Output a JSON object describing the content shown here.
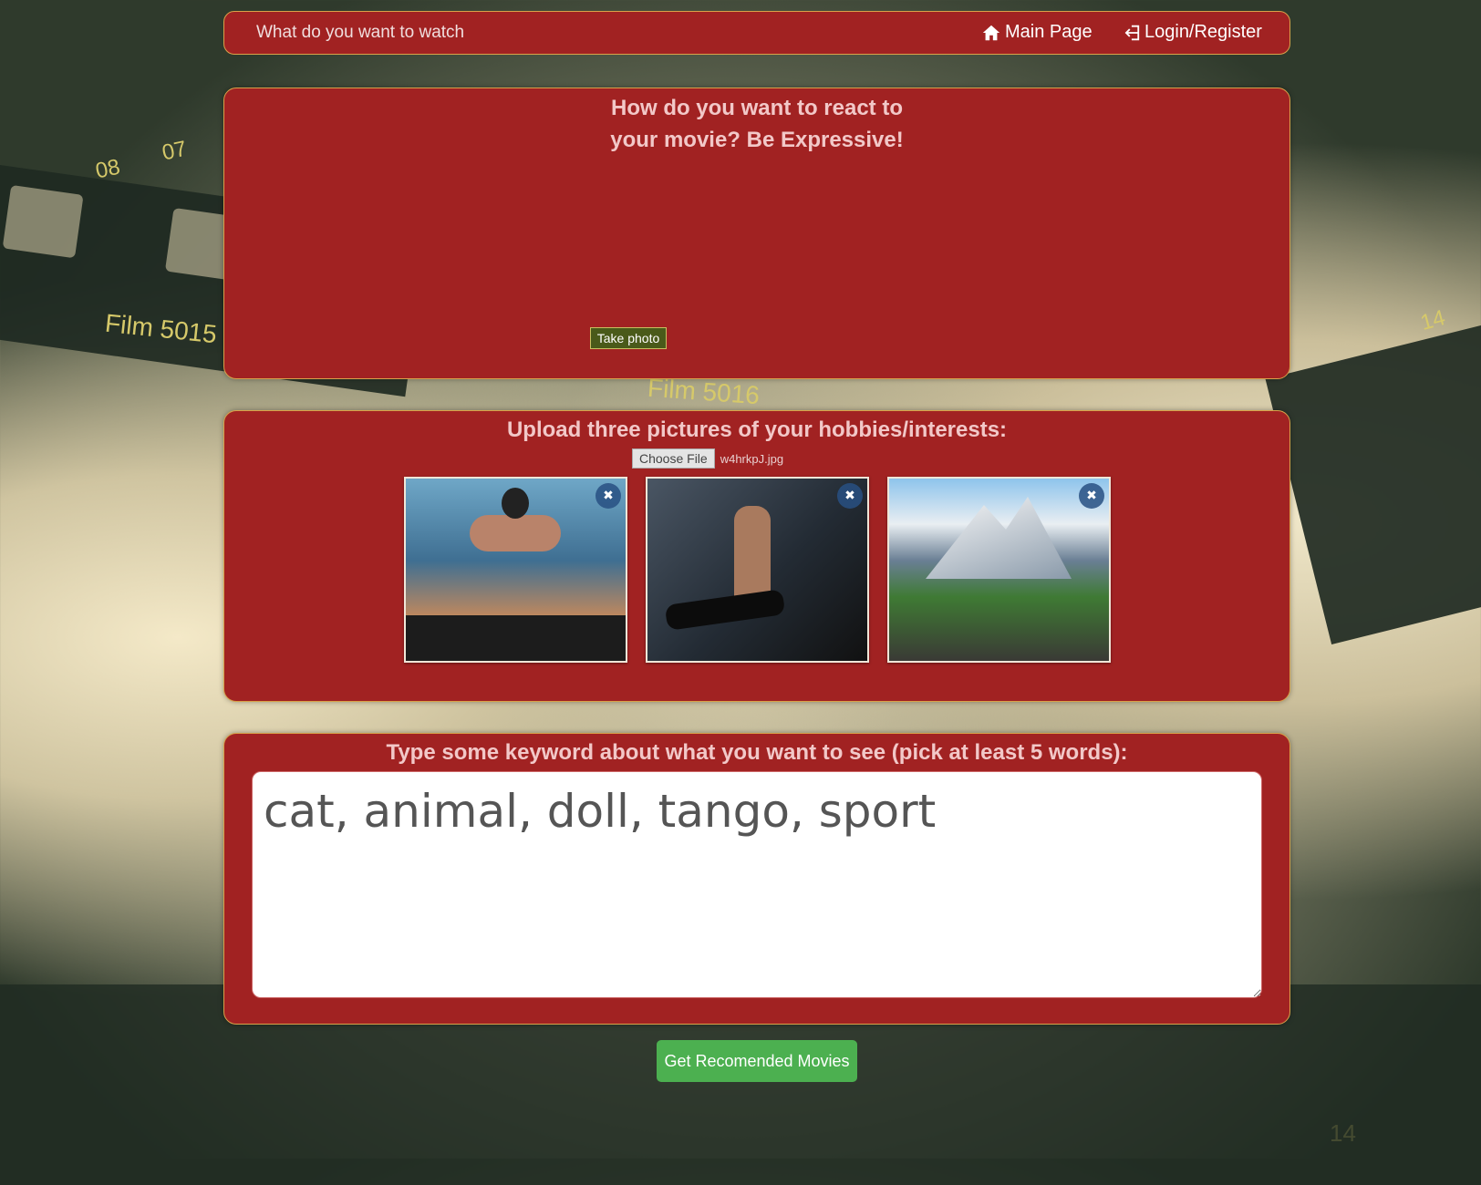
{
  "navbar": {
    "brand": "What do you want to watch",
    "home_label": "Main Page",
    "login_label": "Login/Register"
  },
  "camera_panel": {
    "title": "How do you want to react to your movie? Be Expressive!",
    "take_photo_label": "Take photo"
  },
  "upload_panel": {
    "title": "Upload three pictures of your hobbies/interests:",
    "choose_file_label": "Choose File",
    "file_name": "w4hrkpJ.jpg",
    "remove_glyph": "✖"
  },
  "keywords_panel": {
    "title": "Type some keyword about what you want to see (pick at least 5 words):",
    "value": "cat, animal, doll, tango, sport"
  },
  "submit_label": "Get Recomended Movies",
  "background_labels": {
    "film_a": "Film 5015",
    "film_b": "Film 5016",
    "n08": "08",
    "n07": "07",
    "n14a": "14",
    "n14b": "14"
  },
  "colors": {
    "panel": "#a12222",
    "panel_border": "#d9a24a",
    "title_text": "#f2c8c8",
    "submit": "#4cb050",
    "take_photo": "#4a5a1a"
  },
  "icons": {
    "home": "home-icon",
    "login": "login-icon",
    "remove": "close-icon"
  }
}
